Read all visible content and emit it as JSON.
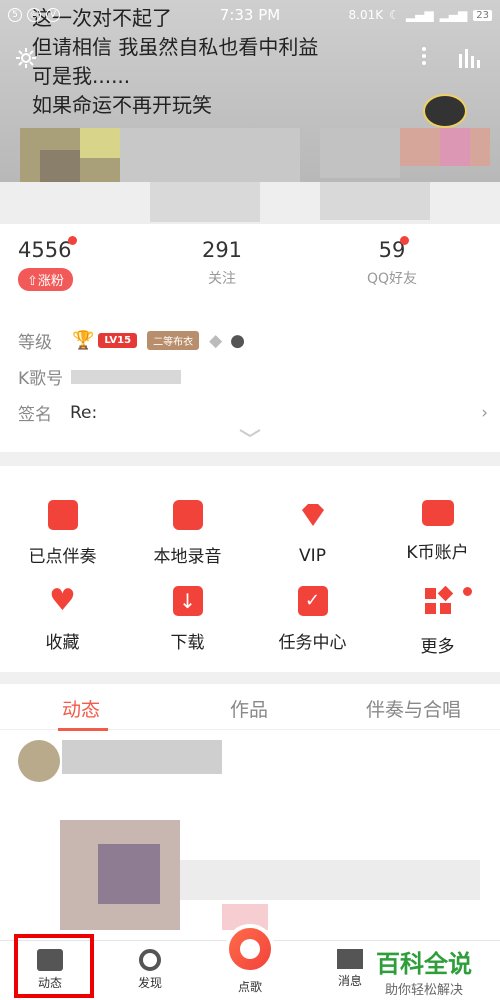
{
  "status_bar": {
    "time": "7:33 PM",
    "network_speed": "8.01K",
    "battery": "23"
  },
  "lyrics": {
    "lines": [
      "这一次对不起了",
      "但请相信 我虽然自私也看中利益",
      "可是我......",
      "如果命运不再开玩笑"
    ]
  },
  "stats": {
    "fans_count": "4556",
    "fans_badge": "涨粉",
    "following_count": "291",
    "following_label": "关注",
    "qq_friends_count": "59",
    "qq_friends_label": "QQ好友"
  },
  "profile": {
    "level_label": "等级",
    "level_badge": "LV15",
    "rank_badge": "二等布衣",
    "kid_label": "K歌号",
    "signature_label": "签名",
    "signature_value": "Re:"
  },
  "menu": {
    "items": [
      {
        "label": "已点伴奏",
        "icon": "accompaniment-icon"
      },
      {
        "label": "本地录音",
        "icon": "local-record-icon"
      },
      {
        "label": "VIP",
        "icon": "vip-diamond-icon"
      },
      {
        "label": "K币账户",
        "icon": "wallet-icon"
      },
      {
        "label": "收藏",
        "icon": "heart-icon"
      },
      {
        "label": "下载",
        "icon": "download-icon"
      },
      {
        "label": "任务中心",
        "icon": "task-calendar-icon"
      },
      {
        "label": "更多",
        "icon": "more-grid-icon"
      }
    ]
  },
  "tabs": [
    {
      "label": "动态",
      "active": true
    },
    {
      "label": "作品",
      "active": false
    },
    {
      "label": "伴奏与合唱",
      "active": false
    }
  ],
  "bottom_nav": {
    "feed": "动态",
    "discover": "发现",
    "sing": "点歌",
    "messages": "消息"
  },
  "watermark": {
    "title": "百科全说",
    "subtitle": "助你轻松解决"
  },
  "colors": {
    "accent": "#f25a4a",
    "highlight": "#ee0000"
  }
}
